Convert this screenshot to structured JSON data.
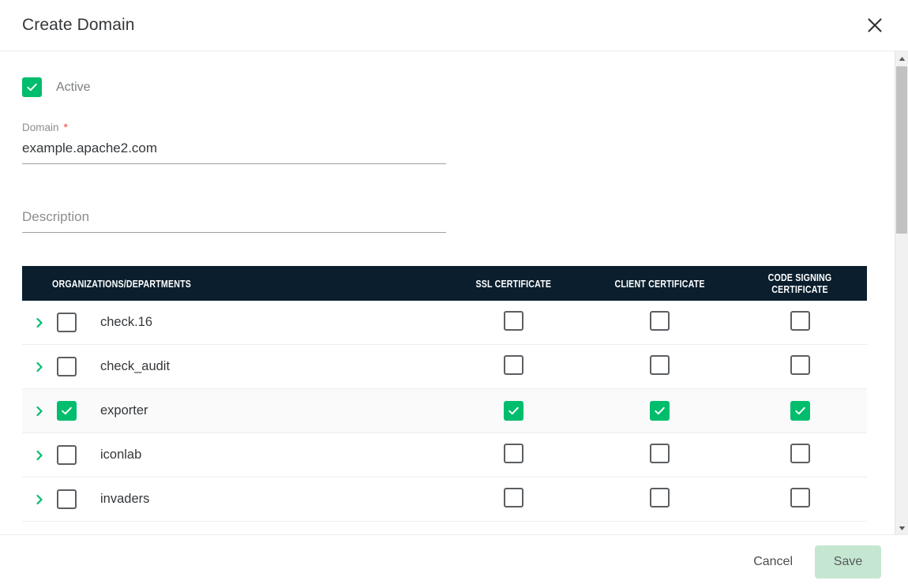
{
  "dialog": {
    "title": "Create Domain",
    "close_icon": "close-icon"
  },
  "form": {
    "active": {
      "label": "Active",
      "checked": true
    },
    "domain": {
      "label": "Domain",
      "required_marker": "*",
      "value": "example.apache2.com",
      "placeholder": ""
    },
    "description": {
      "label": "",
      "value": "",
      "placeholder": "Description"
    }
  },
  "table": {
    "columns": [
      "ORGANIZATIONS/DEPARTMENTS",
      "SSL CERTIFICATE",
      "CLIENT CERTIFICATE",
      "CODE SIGNING CERTIFICATE"
    ],
    "rows": [
      {
        "name": "check.16",
        "selected": false,
        "ssl": false,
        "client": false,
        "code": false,
        "row_highlight": false
      },
      {
        "name": "check_audit",
        "selected": false,
        "ssl": false,
        "client": false,
        "code": false,
        "row_highlight": false
      },
      {
        "name": "exporter",
        "selected": true,
        "ssl": true,
        "client": true,
        "code": true,
        "row_highlight": true
      },
      {
        "name": "iconlab",
        "selected": false,
        "ssl": false,
        "client": false,
        "code": false,
        "row_highlight": false
      },
      {
        "name": "invaders",
        "selected": false,
        "ssl": false,
        "client": false,
        "code": false,
        "row_highlight": false
      }
    ]
  },
  "footer": {
    "cancel_label": "Cancel",
    "save_label": "Save"
  },
  "colors": {
    "accent_green": "#00bd6d",
    "header_navy": "#0a1e2d",
    "required_red": "#f44336",
    "save_disabled_bg": "#c5e7d1"
  }
}
